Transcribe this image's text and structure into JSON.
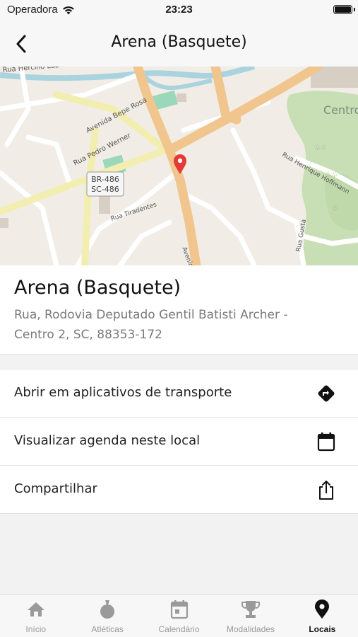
{
  "status_bar": {
    "carrier": "Operadora",
    "time": "23:23"
  },
  "header": {
    "title": "Arena (Basquete)",
    "back_icon": "chevron-left-icon"
  },
  "map": {
    "labels": {
      "hercilio": "Rua Hercílio Luz",
      "bepe_rosa": "Avenida Bepe Rosa",
      "pedro_werner": "Rua Pedro Werner",
      "br486": "BR-486",
      "sc486": "SC-486",
      "tiradentes": "Rua Tiradentes",
      "avenida": "Avenida",
      "henrique": "Rua Henrique Hoffmann",
      "gusta": "Rua Gusta",
      "centro": "Centro"
    },
    "marker_color": "#e53935"
  },
  "place": {
    "name": "Arena (Basquete)",
    "address": "Rua, Rodovia Deputado Gentil Batisti Archer - Centro 2, SC, 88353-172"
  },
  "actions": [
    {
      "label": "Abrir em aplicativos de transporte",
      "icon": "directions-icon"
    },
    {
      "label": "Visualizar agenda neste local",
      "icon": "calendar-icon"
    },
    {
      "label": "Compartilhar",
      "icon": "share-icon"
    }
  ],
  "tabs": [
    {
      "label": "Início",
      "icon": "home-icon",
      "active": false
    },
    {
      "label": "Atléticas",
      "icon": "medal-icon",
      "active": false
    },
    {
      "label": "Calendário",
      "icon": "calendar-icon",
      "active": false
    },
    {
      "label": "Modalidades",
      "icon": "trophy-icon",
      "active": false
    },
    {
      "label": "Locais",
      "icon": "location-pin-icon",
      "active": true
    }
  ]
}
